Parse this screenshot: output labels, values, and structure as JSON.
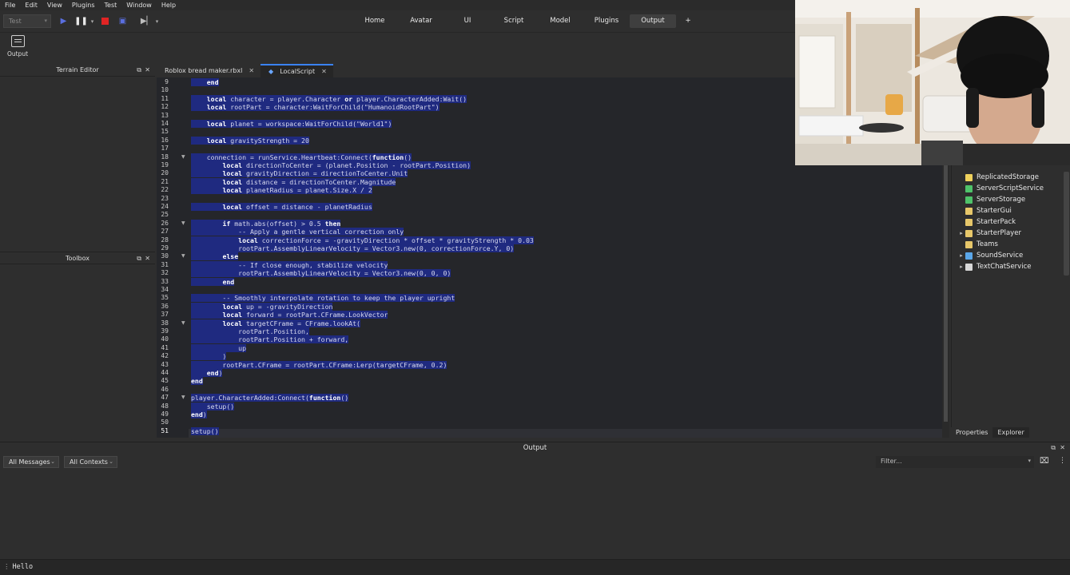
{
  "menu": [
    "File",
    "Edit",
    "View",
    "Plugins",
    "Test",
    "Window",
    "Help"
  ],
  "toolbar": {
    "mode": "Test"
  },
  "top_tabs": [
    "Home",
    "Avatar",
    "UI",
    "Script",
    "Model",
    "Plugins",
    "Output",
    "+"
  ],
  "active_top_tab": "Output",
  "ribbon": {
    "output_label": "Output"
  },
  "panels": {
    "terrain_editor": "Terrain Editor",
    "toolbox": "Toolbox"
  },
  "doc_tabs": [
    {
      "label": "Roblox bread maker.rbxl",
      "close": "✕"
    },
    {
      "label": "LocalScript",
      "close": "✕",
      "active": true
    }
  ],
  "editor": {
    "first_line": 9,
    "lines": [
      "    end",
      "",
      "    local character = player.Character or player.CharacterAdded:Wait()",
      "    local rootPart = character:WaitForChild(\"HumanoidRootPart\")",
      "",
      "    local planet = workspace:WaitForChild(\"World1\")",
      "",
      "    local gravityStrength = 20",
      "",
      "    connection = runService.Heartbeat:Connect(function()",
      "        local directionToCenter = (planet.Position - rootPart.Position)",
      "        local gravityDirection = directionToCenter.Unit",
      "        local distance = directionToCenter.Magnitude",
      "        local planetRadius = planet.Size.X / 2",
      "",
      "        local offset = distance - planetRadius",
      "",
      "        if math.abs(offset) > 0.5 then",
      "            -- Apply a gentle vertical correction only",
      "            local correctionForce = -gravityDirection * offset * gravityStrength * 0.03",
      "            rootPart.AssemblyLinearVelocity = Vector3.new(0, correctionForce.Y, 0)",
      "        else",
      "            -- If close enough, stabilize velocity",
      "            rootPart.AssemblyLinearVelocity = Vector3.new(0, 0, 0)",
      "        end",
      "",
      "        -- Smoothly interpolate rotation to keep the player upright",
      "        local up = -gravityDirection",
      "        local forward = rootPart.CFrame.LookVector",
      "        local targetCFrame = CFrame.lookAt(",
      "            rootPart.Position,",
      "            rootPart.Position + forward,",
      "            up",
      "        )",
      "        rootPart.CFrame = rootPart.CFrame:Lerp(targetCFrame, 0.2)",
      "    end)",
      "end",
      "",
      "player.CharacterAdded:Connect(function()",
      "    setup()",
      "end)",
      "",
      "setup()"
    ],
    "fold_lines": [
      18,
      26,
      30,
      38,
      47
    ]
  },
  "explorer": {
    "items": [
      {
        "label": "ReplicatedStorage",
        "expandable": false,
        "color": "#f0d25c"
      },
      {
        "label": "ServerScriptService",
        "expandable": false,
        "color": "#4fc36a"
      },
      {
        "label": "ServerStorage",
        "expandable": false,
        "color": "#4fc36a"
      },
      {
        "label": "StarterGui",
        "expandable": false,
        "color": "#e7c76a"
      },
      {
        "label": "StarterPack",
        "expandable": false,
        "color": "#e7c76a"
      },
      {
        "label": "StarterPlayer",
        "expandable": true,
        "color": "#e7c76a"
      },
      {
        "label": "Teams",
        "expandable": false,
        "color": "#e7c76a"
      },
      {
        "label": "SoundService",
        "expandable": true,
        "color": "#5aa6e8"
      },
      {
        "label": "TextChatService",
        "expandable": true,
        "color": "#d8d8d8"
      }
    ],
    "tabs": [
      "Properties",
      "Explorer"
    ]
  },
  "output": {
    "title": "Output",
    "messages_filter": "All Messages",
    "contexts_filter": "All Contexts",
    "filter_placeholder": "Filter...",
    "command_text": "Hello"
  }
}
